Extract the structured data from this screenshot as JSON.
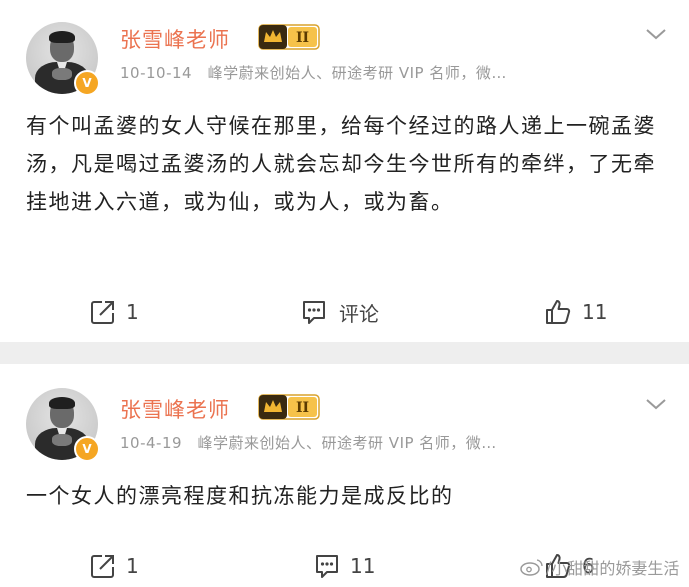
{
  "posts": [
    {
      "author": "张雪峰老师",
      "level_badge": "II",
      "meta": "10-10-14　峰学蔚来创始人、研途考研 VIP 名师，微…",
      "verified_badge": "V",
      "text": "有个叫孟婆的女人守候在那里，给每个经过的路人递上一碗孟婆汤，凡是喝过孟婆汤的人就会忘却今生今世所有的牵绊，了无牵挂地进入六道，或为仙，或为人，或为畜。",
      "repost_count": "1",
      "comment_label": "评论",
      "like_count": "11"
    },
    {
      "author": "张雪峰老师",
      "level_badge": "II",
      "meta": "10-4-19　峰学蔚来创始人、研途考研 VIP 名师，微…",
      "verified_badge": "V",
      "text": "一个女人的漂亮程度和抗冻能力是成反比的",
      "repost_count": "1",
      "comment_count": "11",
      "like_count": "6"
    }
  ],
  "watermark": "小甜甜的娇妻生活",
  "colors": {
    "author": "#eb7350",
    "meta": "#999999",
    "text": "#222222",
    "divider": "#eeeeee",
    "verified": "#f5a623",
    "crown": "#e6a817"
  },
  "icons": [
    "repost-icon",
    "comment-icon",
    "like-icon",
    "chevron-down-icon",
    "crown-icon",
    "weibo-logo-icon"
  ]
}
